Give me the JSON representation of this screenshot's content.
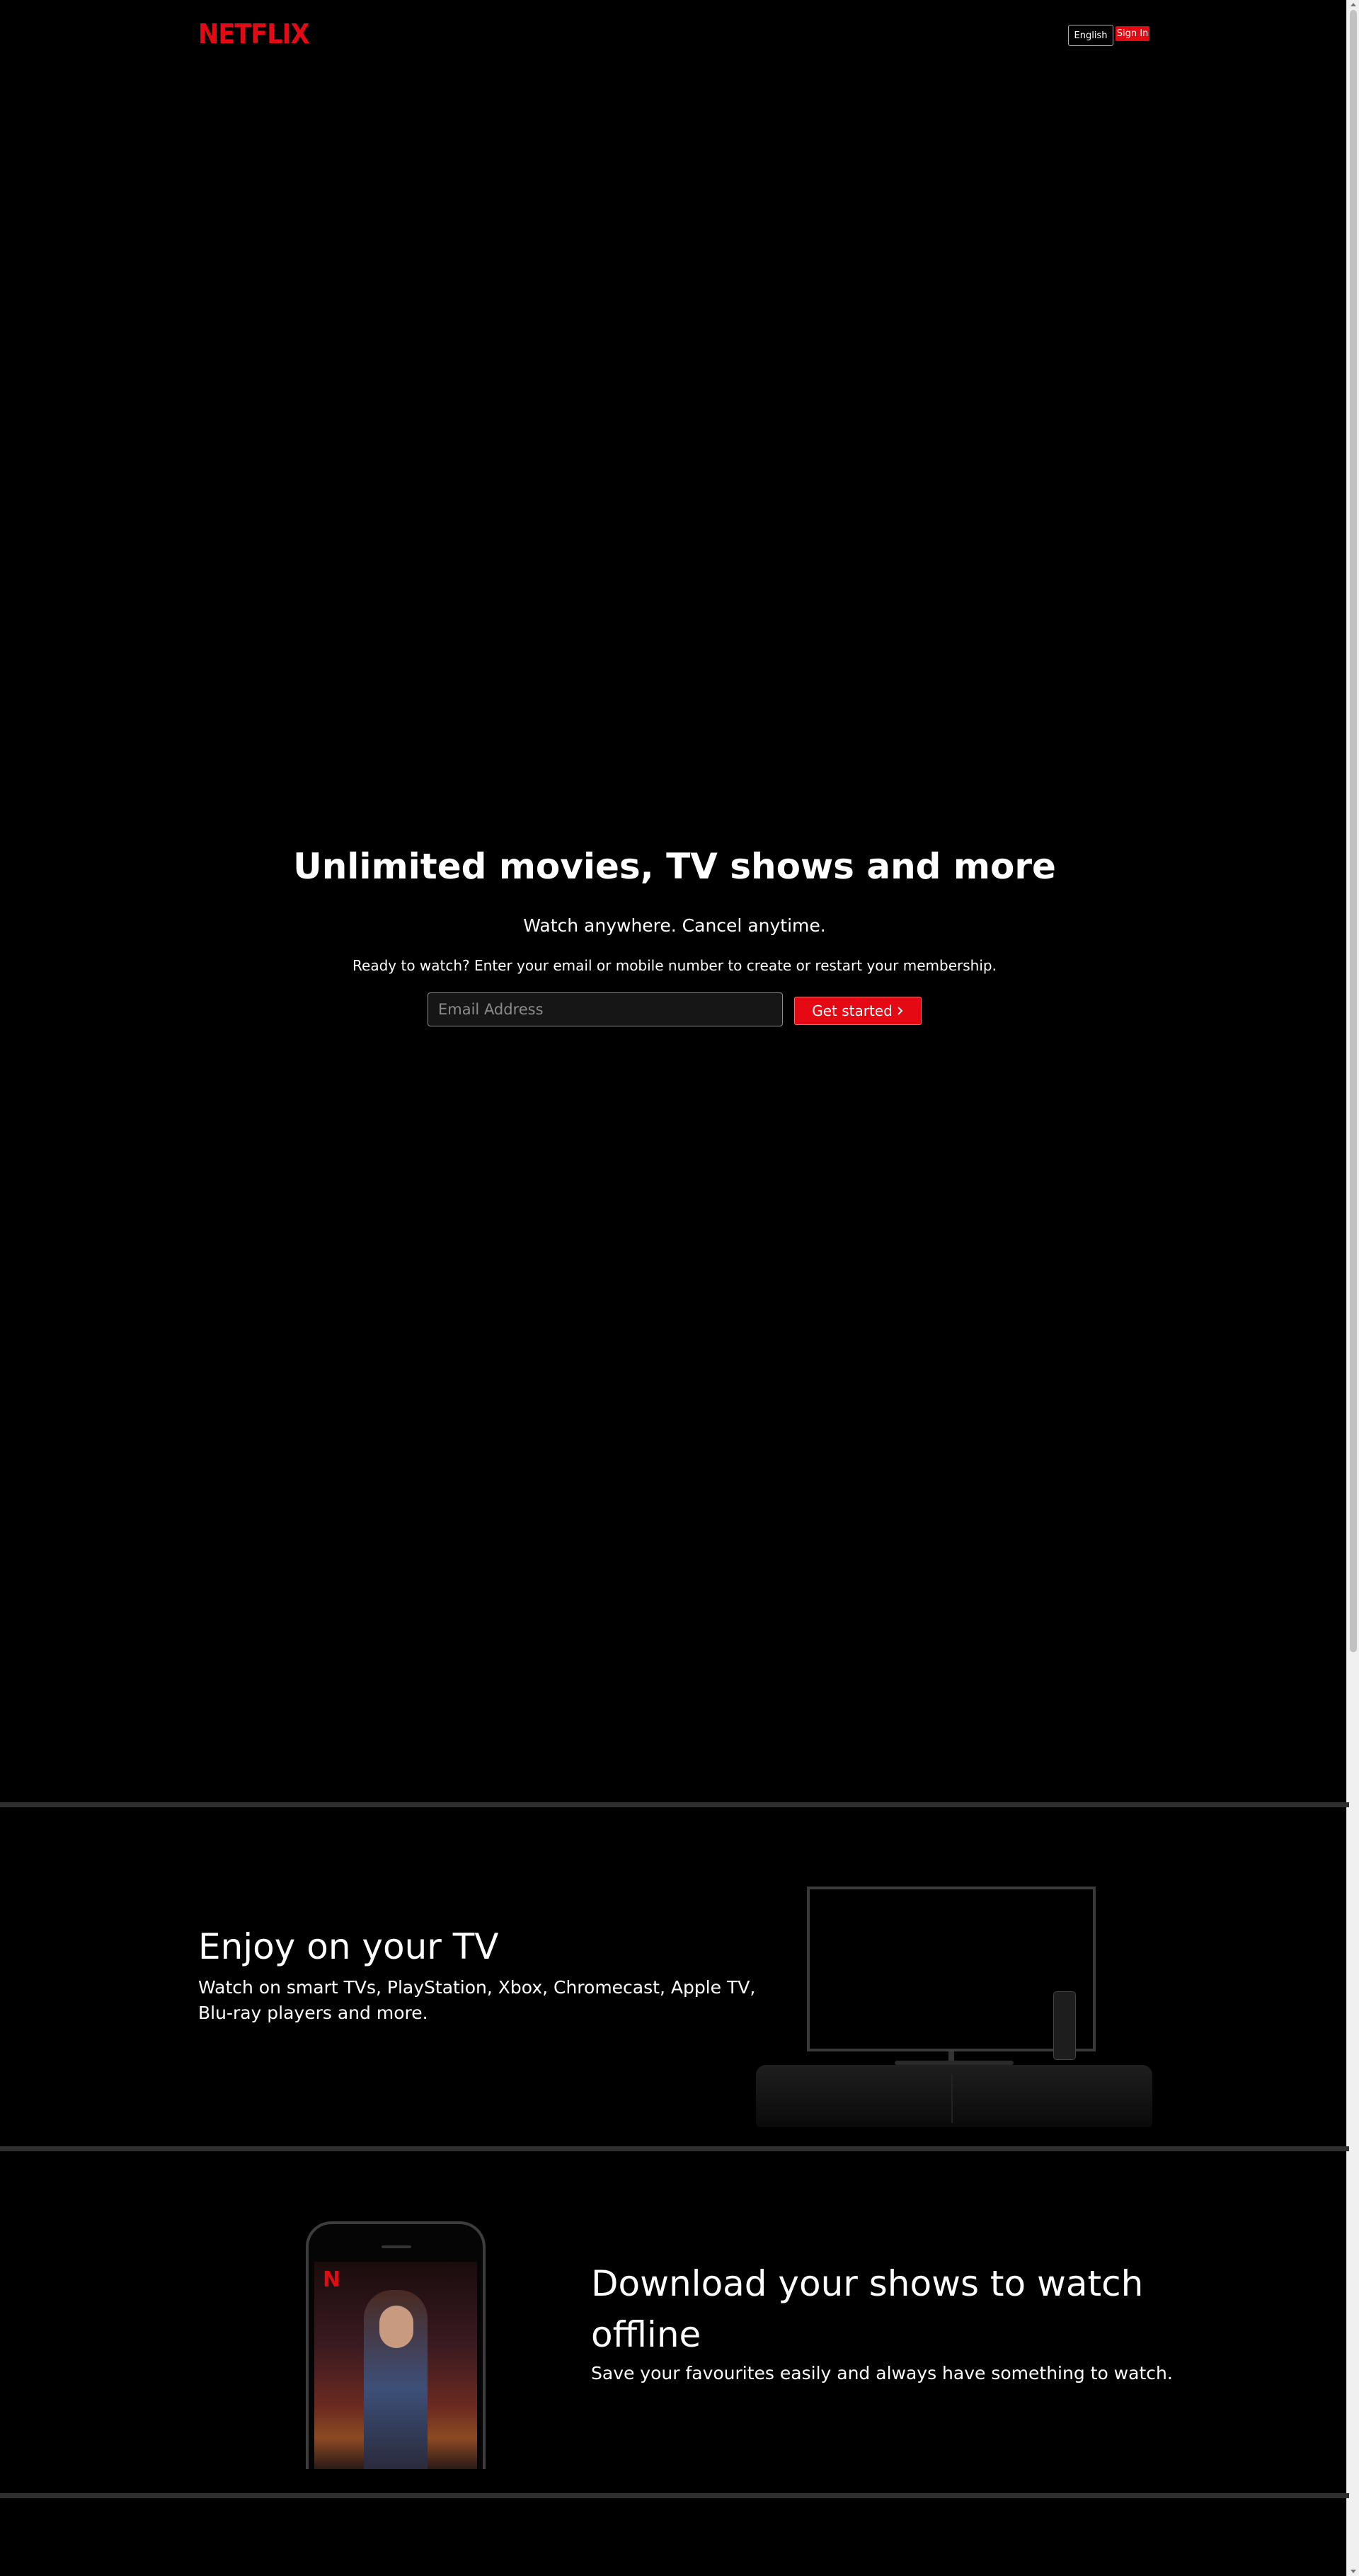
{
  "header": {
    "logo": "NETFLIX",
    "language_label": "English",
    "signin_label": "Sign In"
  },
  "hero": {
    "title": "Unlimited movies, TV shows and more",
    "subtitle": "Watch anywhere. Cancel anytime.",
    "ready_text": "Ready to watch? Enter your email or mobile number to create or restart your membership.",
    "email_placeholder": "Email Address",
    "cta_label": "Get started",
    "cta_icon": "chevron-right-icon"
  },
  "features": [
    {
      "title": "Enjoy on your TV",
      "description": "Watch on smart TVs, PlayStation, Xbox, Chromecast, Apple TV, Blu-ray players and more."
    },
    {
      "title": "Download your shows to watch offline",
      "description": "Save your favourites easily and always have something to watch."
    }
  ],
  "colors": {
    "brand": "#e50914",
    "background": "#000000",
    "divider": "#2f2f2f"
  }
}
